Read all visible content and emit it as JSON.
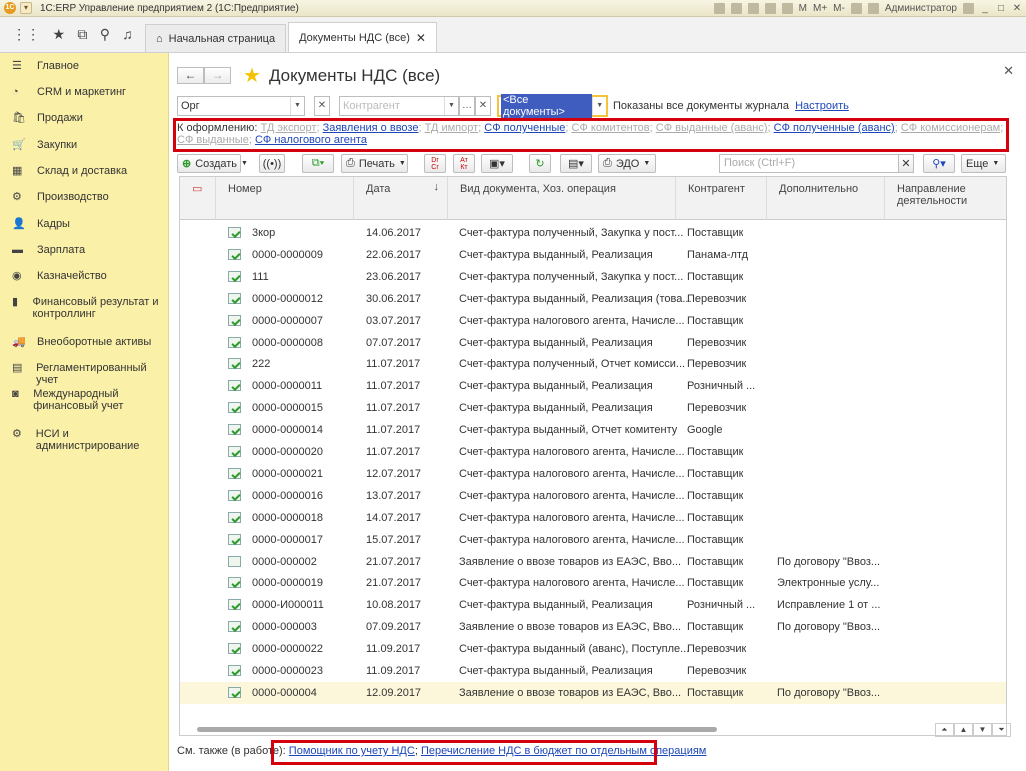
{
  "app": {
    "title": "1С:ERP Управление предприятием 2  (1С:Предприятие)",
    "user": "Администратор",
    "m_labels": [
      "M",
      "M+",
      "M-"
    ]
  },
  "tabs": {
    "home": "Начальная страница",
    "active": "Документы НДС (все)"
  },
  "sidebar": {
    "items": [
      {
        "label": "Главное",
        "icon": "menu-icon"
      },
      {
        "label": "CRM и маркетинг",
        "icon": "pie-icon"
      },
      {
        "label": "Продажи",
        "icon": "bag-icon"
      },
      {
        "label": "Закупки",
        "icon": "cart-icon"
      },
      {
        "label": "Склад и доставка",
        "icon": "warehouse-icon"
      },
      {
        "label": "Производство",
        "icon": "factory-icon"
      },
      {
        "label": "Кадры",
        "icon": "people-icon"
      },
      {
        "label": "Зарплата",
        "icon": "money-icon"
      },
      {
        "label": "Казначейство",
        "icon": "coin-icon"
      },
      {
        "label": "Финансовый результат и контроллинг",
        "icon": "chart-icon"
      },
      {
        "label": "Внеоборотные активы",
        "icon": "car-icon"
      },
      {
        "label": "Регламентированный учет",
        "icon": "report-icon"
      },
      {
        "label": "Международный финансовый учет",
        "icon": "intl-icon"
      },
      {
        "label": "НСИ и администрирование",
        "icon": "gear-icon"
      }
    ]
  },
  "form": {
    "title": "Документы НДС (все)",
    "org_value": "Орг",
    "counterparty_placeholder": "Контрагент",
    "doc_select": "<Все документы>",
    "shown_note": "Показаны все документы журнала",
    "configure": "Настроить"
  },
  "oform": {
    "label": "К оформлению:",
    "items": [
      {
        "text": "ТД экспорт",
        "active": false
      },
      {
        "text": "Заявления о ввозе",
        "active": true
      },
      {
        "text": "ТД импорт",
        "active": false
      },
      {
        "text": "СФ полученные",
        "active": true
      },
      {
        "text": "СФ комитентов",
        "active": false
      },
      {
        "text": "СФ выданные (аванс)",
        "active": false
      },
      {
        "text": "СФ полученные (аванс)",
        "active": true
      },
      {
        "text": "СФ комиссионерам",
        "active": false
      },
      {
        "text": "СФ выданные",
        "active": false
      },
      {
        "text": "СФ налогового агента",
        "active": true
      }
    ]
  },
  "toolbar": {
    "create": "Создать",
    "print": "Печать",
    "edo": "ЭДО",
    "search_placeholder": "Поиск (Ctrl+F)",
    "more": "Еще",
    "dr_label": "Dr",
    "cr_label": "Cr",
    "at_label": "Ат",
    "kt_label": "Кт"
  },
  "columns": {
    "number": "Номер",
    "date": "Дата",
    "kind": "Вид документа, Хоз. операция",
    "counterparty": "Контрагент",
    "extra": "Дополнительно",
    "direction": "Направление деятельности"
  },
  "rows": [
    {
      "num": "3кор",
      "date": "14.06.2017",
      "kind": "Счет-фактура полученный, Закупка у пост...",
      "cp": "Поставщик",
      "extra": "",
      "icon": "check"
    },
    {
      "num": "0000-0000009",
      "date": "22.06.2017",
      "kind": "Счет-фактура выданный, Реализация",
      "cp": "Панама-лтд",
      "extra": "",
      "icon": "check"
    },
    {
      "num": "111",
      "date": "23.06.2017",
      "kind": "Счет-фактура полученный, Закупка у пост...",
      "cp": "Поставщик",
      "extra": "",
      "icon": "check"
    },
    {
      "num": "0000-0000012",
      "date": "30.06.2017",
      "kind": "Счет-фактура выданный, Реализация (това...",
      "cp": "Перевозчик",
      "extra": "",
      "icon": "check"
    },
    {
      "num": "0000-0000007",
      "date": "03.07.2017",
      "kind": "Счет-фактура налогового агента, Начисле...",
      "cp": "Поставщик",
      "extra": "",
      "icon": "check"
    },
    {
      "num": "0000-0000008",
      "date": "07.07.2017",
      "kind": "Счет-фактура выданный, Реализация",
      "cp": "Перевозчик",
      "extra": "",
      "icon": "check"
    },
    {
      "num": "222",
      "date": "11.07.2017",
      "kind": "Счет-фактура полученный, Отчет комисси...",
      "cp": "Перевозчик",
      "extra": "",
      "icon": "check"
    },
    {
      "num": "0000-0000011",
      "date": "11.07.2017",
      "kind": "Счет-фактура выданный, Реализация",
      "cp": "Розничный ...",
      "extra": "",
      "icon": "check"
    },
    {
      "num": "0000-0000015",
      "date": "11.07.2017",
      "kind": "Счет-фактура выданный, Реализация",
      "cp": "Перевозчик",
      "extra": "",
      "icon": "check"
    },
    {
      "num": "0000-0000014",
      "date": "11.07.2017",
      "kind": "Счет-фактура выданный, Отчет комитенту",
      "cp": "Google",
      "extra": "",
      "icon": "check"
    },
    {
      "num": "0000-0000020",
      "date": "11.07.2017",
      "kind": "Счет-фактура налогового агента, Начисле...",
      "cp": "Поставщик",
      "extra": "",
      "icon": "check"
    },
    {
      "num": "0000-0000021",
      "date": "12.07.2017",
      "kind": "Счет-фактура налогового агента, Начисле...",
      "cp": "Поставщик",
      "extra": "",
      "icon": "check"
    },
    {
      "num": "0000-0000016",
      "date": "13.07.2017",
      "kind": "Счет-фактура налогового агента, Начисле...",
      "cp": "Поставщик",
      "extra": "",
      "icon": "check"
    },
    {
      "num": "0000-0000018",
      "date": "14.07.2017",
      "kind": "Счет-фактура налогового агента, Начисле...",
      "cp": "Поставщик",
      "extra": "",
      "icon": "check"
    },
    {
      "num": "0000-0000017",
      "date": "15.07.2017",
      "kind": "Счет-фактура налогового агента, Начисле...",
      "cp": "Поставщик",
      "extra": "",
      "icon": "check"
    },
    {
      "num": "0000-000002",
      "date": "21.07.2017",
      "kind": "Заявление о ввозе товаров из ЕАЭС, Вво...",
      "cp": "Поставщик",
      "extra": "По договору \"Ввоз...",
      "icon": "plain"
    },
    {
      "num": "0000-0000019",
      "date": "21.07.2017",
      "kind": "Счет-фактура налогового агента, Начисле...",
      "cp": "Поставщик",
      "extra": "Электронные услу...",
      "icon": "check"
    },
    {
      "num": "0000-И000011",
      "date": "10.08.2017",
      "kind": "Счет-фактура выданный, Реализация",
      "cp": "Розничный ...",
      "extra": "Исправление 1 от ...",
      "icon": "check"
    },
    {
      "num": "0000-000003",
      "date": "07.09.2017",
      "kind": "Заявление о ввозе товаров из ЕАЭС, Вво...",
      "cp": "Поставщик",
      "extra": "По договору \"Ввоз...",
      "icon": "check"
    },
    {
      "num": "0000-0000022",
      "date": "11.09.2017",
      "kind": "Счет-фактура выданный (аванс), Поступле...",
      "cp": "Перевозчик",
      "extra": "",
      "icon": "check"
    },
    {
      "num": "0000-0000023",
      "date": "11.09.2017",
      "kind": "Счет-фактура выданный, Реализация",
      "cp": "Перевозчик",
      "extra": "",
      "icon": "check"
    },
    {
      "num": "0000-000004",
      "date": "12.09.2017",
      "kind": "Заявление о ввозе товаров из ЕАЭС, Вво...",
      "cp": "Поставщик",
      "extra": "По договору \"Ввоз...",
      "icon": "check"
    }
  ],
  "footer": {
    "label": "См. также (в работе):",
    "link1": "Помощник по учету НДС",
    "sep": ";",
    "link2": "Перечисление НДС в бюджет по отдельным операциям"
  }
}
